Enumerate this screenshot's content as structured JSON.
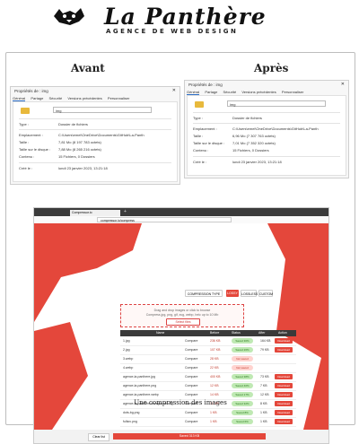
{
  "brand": {
    "name": "La Panthère",
    "tagline": "AGENCE DE WEB DESIGN"
  },
  "comparison": {
    "before_label": "Avant",
    "after_label": "Après",
    "caption": "Une compression des images"
  },
  "before_dialog": {
    "title": "Propriétés de : img",
    "close": "✕",
    "tabs": [
      "Général",
      "Partage",
      "Sécurité",
      "Versions précédentes",
      "Personnaliser"
    ],
    "folder_name": "img",
    "type_label": "Type :",
    "type_value": "Dossier de fichiers",
    "location_label": "Emplacement :",
    "location_value": "C:\\Users\\emel\\OneDrive\\Documents\\GitHub\\La-Panth",
    "size_label": "Taille :",
    "size_value": "7,81 Mo (8 197 783 octets)",
    "disk_label": "Taille sur le disque :",
    "disk_value": "7,88 Mo (8 265 216 octets)",
    "contents_label": "Contenu :",
    "contents_value": "15 Fichiers, 0 Dossiers",
    "created_label": "Créé le :",
    "created_value": "lundi 23 janvier 2023, 13:21:18"
  },
  "after_dialog": {
    "title": "Propriétés de : img",
    "close": "✕",
    "tabs": [
      "Général",
      "Partage",
      "Sécurité",
      "Versions précédentes",
      "Personnaliser"
    ],
    "folder_name": "img",
    "type_label": "Type :",
    "type_value": "Dossier de fichiers",
    "location_label": "Emplacement :",
    "location_value": "C:\\Users\\emel\\OneDrive\\Documents\\GitHub\\La-Panth",
    "size_label": "Taille :",
    "size_value": "6,96 Mo (7 307 763 octets)",
    "disk_label": "Taille sur le disque :",
    "disk_value": "7,01 Mo (7 352 320 octets)",
    "contents_label": "Contenu :",
    "contents_value": "15 Fichiers, 0 Dossiers",
    "created_label": "Créé le :",
    "created_value": "lundi 23 janvier 2023, 13:21:18"
  },
  "browser": {
    "tab_label": "Compressor.io",
    "new_tab": "+",
    "url": "compressor.io/compress",
    "compression_label": "COMPRESSION TYPE",
    "lossy": "LOSSY",
    "lossless": "LOSSLESS",
    "custom": "CUSTOM",
    "drop_line1": "Drag and drop images or click to browse",
    "drop_line2": "Compress jpg, png, gif, svg, webp, heic up to 10 Mb",
    "select_files": "Select files",
    "columns": [
      "Name",
      "Before",
      "Status",
      "After",
      "Action"
    ],
    "rows": [
      {
        "name": "1.jpg",
        "compare": "Compare",
        "before": "236 KB",
        "status": "Saved 30%",
        "ok": true,
        "after": "164 KB",
        "action": "Download"
      },
      {
        "name": "2.jpg",
        "compare": "Compare",
        "before": "107 KB",
        "status": "Saved 26%",
        "ok": true,
        "after": "79 KB",
        "action": "Download"
      },
      {
        "name": "3.webp",
        "compare": "Compare",
        "before": "28 KB",
        "status": "Not saved",
        "ok": false,
        "after": "",
        "action": ""
      },
      {
        "name": "4.webp",
        "compare": "Compare",
        "before": "22 KB",
        "status": "Not saved",
        "ok": false,
        "after": "",
        "action": ""
      },
      {
        "name": "agence-la-panthere.jpg",
        "compare": "Compare",
        "before": "400 KB",
        "status": "Saved 38%",
        "ok": true,
        "after": "73 KB",
        "action": "Download"
      },
      {
        "name": "agence-la-panthere.png",
        "compare": "Compare",
        "before": "12 KB",
        "status": "Saved 40%",
        "ok": true,
        "after": "7 KB",
        "action": "Download"
      },
      {
        "name": "agence-la-panthere.webp",
        "compare": "Compare",
        "before": "14 KB",
        "status": "Saved 17%",
        "ok": true,
        "after": "12 KB",
        "action": "Download"
      },
      {
        "name": "agence-la-panthere-transparent.svg",
        "compare": "Compare",
        "before": "12 KB",
        "status": "Saved 32%",
        "ok": true,
        "after": "8 KB",
        "action": "Download"
      },
      {
        "name": "dots-bg.png",
        "compare": "Compare",
        "before": "1 KB",
        "status": "Saved 8%",
        "ok": true,
        "after": "1 KB",
        "action": "Download"
      },
      {
        "name": "fullsrc.png",
        "compare": "Compare",
        "before": "1 KB",
        "status": "Saved 6%",
        "ok": true,
        "after": "1 KB",
        "action": "Download"
      }
    ],
    "clear_all": "Clear list",
    "saved_summary": "Saved 313 KB"
  },
  "colors": {
    "accent": "#e4473b"
  }
}
